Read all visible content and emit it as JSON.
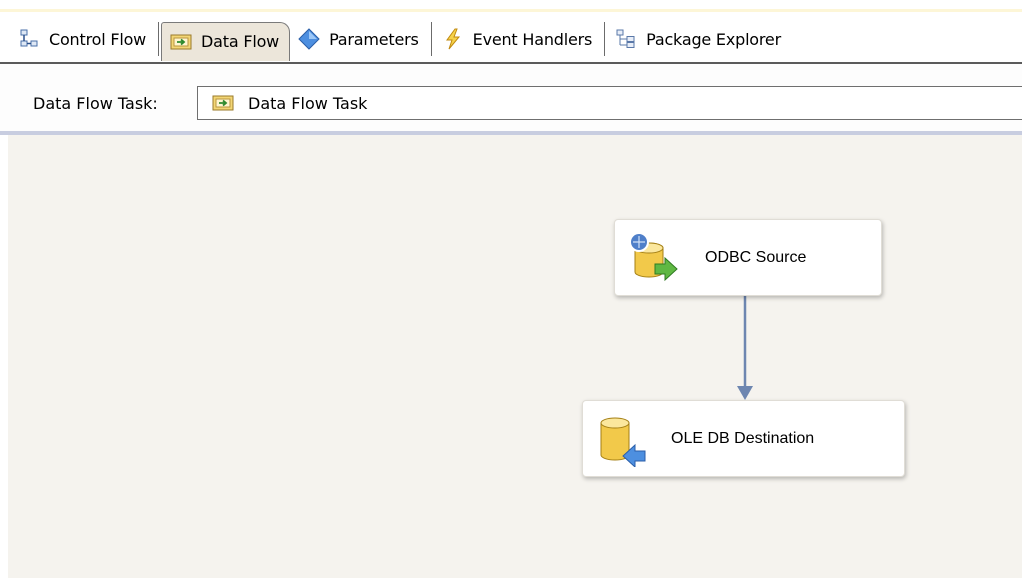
{
  "tabs": [
    {
      "label": "Control Flow",
      "icon": "control-flow-icon",
      "active": false
    },
    {
      "label": "Data Flow",
      "icon": "data-flow-icon",
      "active": true
    },
    {
      "label": "Parameters",
      "icon": "parameters-icon",
      "active": false
    },
    {
      "label": "Event Handlers",
      "icon": "event-handlers-icon",
      "active": false
    },
    {
      "label": "Package Explorer",
      "icon": "package-explorer-icon",
      "active": false
    }
  ],
  "task_selector": {
    "label": "Data Flow Task:",
    "value": "Data Flow Task",
    "icon": "data-flow-task-icon"
  },
  "components": {
    "source": {
      "label": "ODBC Source",
      "icon": "odbc-source-icon"
    },
    "destination": {
      "label": "OLE DB Destination",
      "icon": "ole-db-destination-icon"
    }
  },
  "colors": {
    "canvas_background": "#f5f3ee",
    "path_arrow": "#6d86b0",
    "active_tab": "#ece6da"
  }
}
